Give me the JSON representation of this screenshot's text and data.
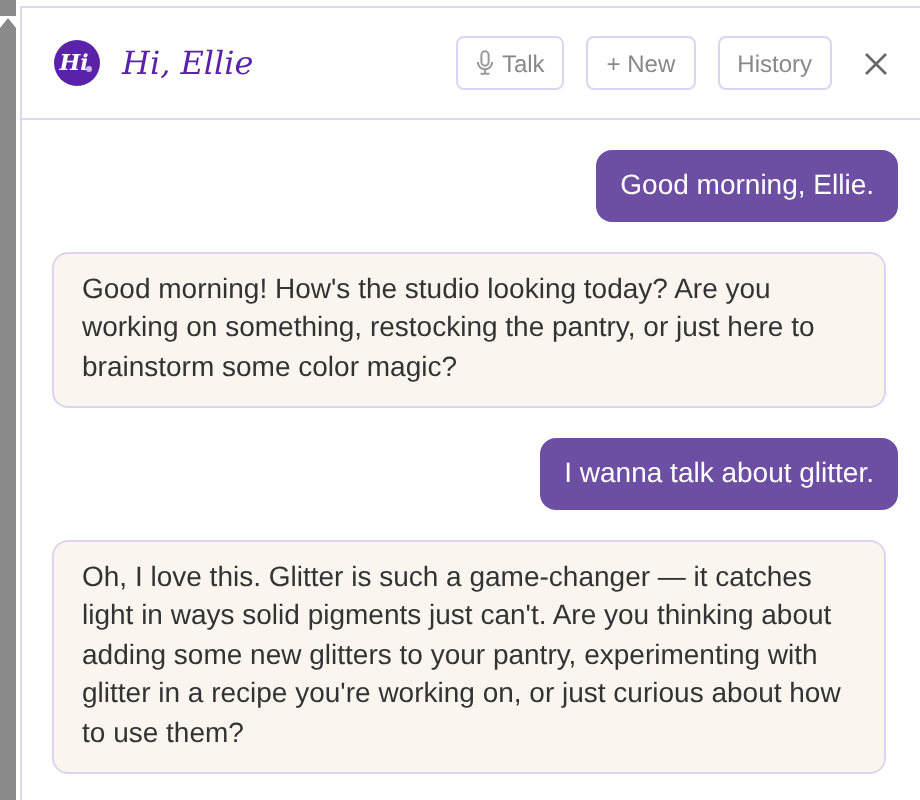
{
  "header": {
    "avatar": {
      "text": "Hi"
    },
    "title": "Hi, Ellie",
    "buttons": [
      {
        "label": "Talk",
        "kind": "talk"
      },
      {
        "label": "+ New",
        "kind": "plain"
      },
      {
        "label": "History",
        "kind": "plain"
      }
    ]
  },
  "messages": [
    {
      "kind": "user",
      "text": "Good morning, Ellie."
    },
    {
      "kind": "assistant",
      "text": "Good morning! How's the studio looking today? Are you working on something, restocking the pantry, or just here to brainstorm some color magic?"
    },
    {
      "kind": "user",
      "text": "I wanna talk about glitter."
    },
    {
      "kind": "assistant",
      "text": "Oh, I love this. Glitter is such a game-changer — it catches light in ways solid pigments just can't. Are you thinking about adding some new glitters to your pantry, experimenting with glitter in a recipe you're working on, or just curious about how to use them?"
    }
  ]
}
